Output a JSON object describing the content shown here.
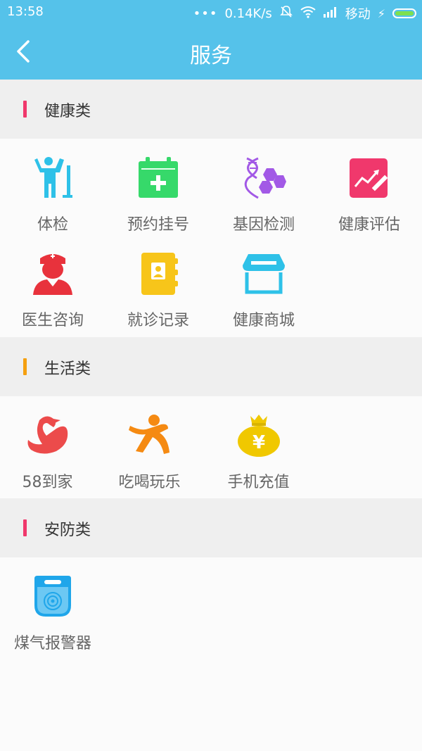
{
  "status_bar": {
    "time": "13:58",
    "network_speed": "0.14K/s",
    "carrier": "移动",
    "icons": [
      "dots-icon",
      "mute-icon",
      "wifi-icon",
      "signal-icon",
      "charging-icon",
      "battery-icon"
    ]
  },
  "header": {
    "title": "服务",
    "back_icon": "chevron-left-icon",
    "background_color": "#55c2ea"
  },
  "sections": [
    {
      "label": "健康类",
      "accent_color": "#f0386c",
      "items": [
        {
          "label": "体检",
          "icon": "checkup-icon",
          "color": "#2ec1e8"
        },
        {
          "label": "预约挂号",
          "icon": "calendar-plus-icon",
          "color": "#36d96a"
        },
        {
          "label": "基因检测",
          "icon": "dna-icon",
          "color": "#a259e6"
        },
        {
          "label": "健康评估",
          "icon": "chart-pen-icon",
          "color": "#f0386c"
        },
        {
          "label": "医生咨询",
          "icon": "doctor-icon",
          "color": "#e8323c"
        },
        {
          "label": "就诊记录",
          "icon": "record-book-icon",
          "color": "#f7c51a"
        },
        {
          "label": "健康商城",
          "icon": "store-icon",
          "color": "#2ec1e8"
        }
      ]
    },
    {
      "label": "生活类",
      "accent_color": "#f5a010",
      "items": [
        {
          "label": "58到家",
          "icon": "swan-icon",
          "color": "#ec4b4b"
        },
        {
          "label": "吃喝玩乐",
          "icon": "person-jump-icon",
          "color": "#f58a12"
        },
        {
          "label": "手机充值",
          "icon": "money-bag-icon",
          "color": "#f0c800"
        }
      ]
    },
    {
      "label": "安防类",
      "accent_color": "#f0386c",
      "items": [
        {
          "label": "煤气报警器",
          "icon": "gas-alarm-icon",
          "color": "#1fa6ea"
        }
      ]
    }
  ]
}
